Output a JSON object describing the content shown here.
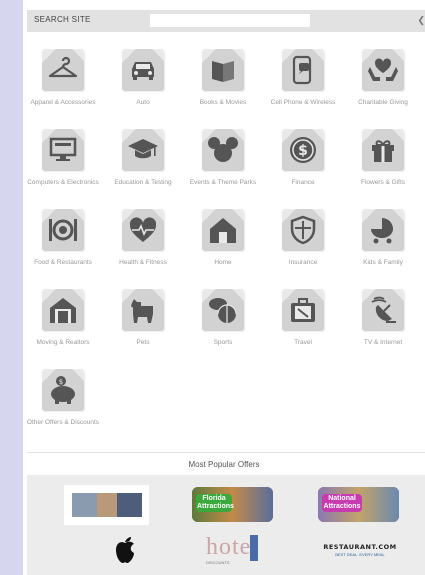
{
  "search": {
    "label": "SEARCH SITE",
    "value": "",
    "go_glyph": "❮"
  },
  "categories": [
    {
      "label": "Apparel & Accessories",
      "icon": "hanger-icon"
    },
    {
      "label": "Auto",
      "icon": "car-icon"
    },
    {
      "label": "Books & Movies",
      "icon": "book-icon"
    },
    {
      "label": "Cell Phone & Wireless",
      "icon": "phone-icon"
    },
    {
      "label": "Charitable Giving",
      "icon": "heart-hands-icon"
    },
    {
      "label": "Computers & Electronics",
      "icon": "monitor-icon"
    },
    {
      "label": "Education & Testing",
      "icon": "graduation-cap-icon"
    },
    {
      "label": "Events & Theme Parks",
      "icon": "mouse-ears-icon"
    },
    {
      "label": "Finance",
      "icon": "dollar-coin-icon"
    },
    {
      "label": "Flowers & Gifts",
      "icon": "gift-icon"
    },
    {
      "label": "Food & Restaurants",
      "icon": "plate-utensils-icon"
    },
    {
      "label": "Health & Fitness",
      "icon": "heartbeat-icon"
    },
    {
      "label": "Home",
      "icon": "house-icon"
    },
    {
      "label": "Insurance",
      "icon": "shield-icon"
    },
    {
      "label": "Kids & Family",
      "icon": "stroller-icon"
    },
    {
      "label": "Moving & Realtors",
      "icon": "moving-house-icon"
    },
    {
      "label": "Pets",
      "icon": "dog-icon"
    },
    {
      "label": "Sports",
      "icon": "sports-balls-icon"
    },
    {
      "label": "Travel",
      "icon": "suitcase-icon"
    },
    {
      "label": "TV & Internet",
      "icon": "satellite-dish-icon"
    },
    {
      "label": "Other Offers & Discounts",
      "icon": "piggy-bank-icon"
    }
  ],
  "popular": {
    "title": "Most Popular Offers",
    "offers": [
      {
        "name": "photo-offer",
        "label": ""
      },
      {
        "name": "florida-attractions",
        "label": "Florida Attractions"
      },
      {
        "name": "national-attractions",
        "label": "National Attractions"
      },
      {
        "name": "apple-offer",
        "label": ""
      },
      {
        "name": "hotel-discounts",
        "label": "hotel",
        "sub": "DISCOUNTS"
      },
      {
        "name": "restaurant-com",
        "label": "RESTAURANT.COM",
        "sub": "BEST DEAL. EVERY MEAL"
      }
    ]
  },
  "colors": {
    "background": "#d6d6ee",
    "tile": "#e9e9e9",
    "icon": "#555555",
    "offers_bg": "#ececec"
  }
}
